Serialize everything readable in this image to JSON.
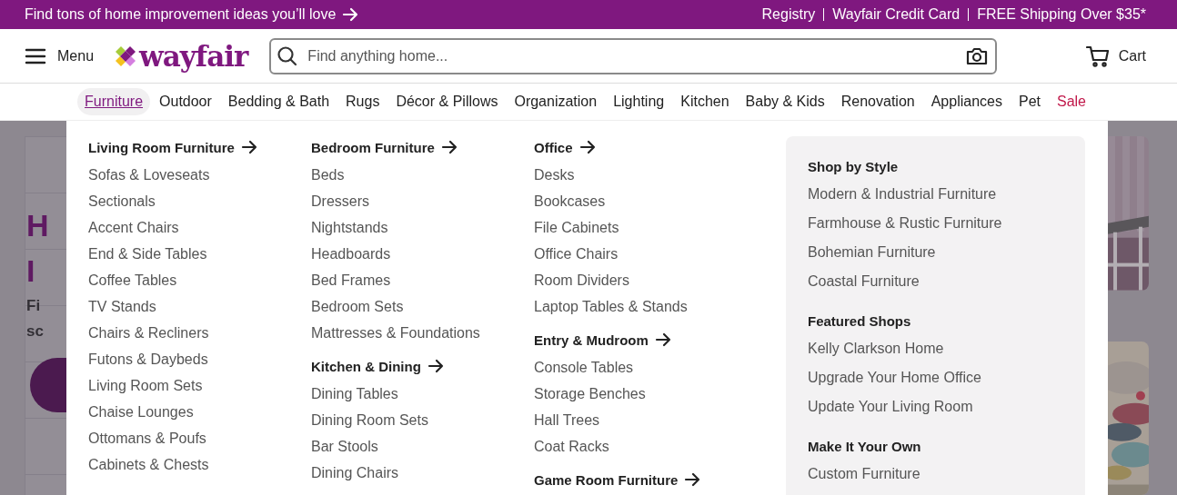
{
  "promo_bar": {
    "text": "Find tons of home improvement ideas you’ll love",
    "links": [
      "Registry",
      "Wayfair Credit Card",
      "FREE Shipping Over $35*"
    ]
  },
  "header": {
    "menu_label": "Menu",
    "logo": "wayfair",
    "search": {
      "placeholder": "Find anything home..."
    },
    "cart_label": "Cart"
  },
  "nav": [
    {
      "label": "Furniture",
      "selected": true,
      "kind": "normal"
    },
    {
      "label": "Outdoor",
      "selected": false,
      "kind": "normal"
    },
    {
      "label": "Bedding & Bath",
      "selected": false,
      "kind": "normal"
    },
    {
      "label": "Rugs",
      "selected": false,
      "kind": "normal"
    },
    {
      "label": "Décor & Pillows",
      "selected": false,
      "kind": "normal"
    },
    {
      "label": "Organization",
      "selected": false,
      "kind": "normal"
    },
    {
      "label": "Lighting",
      "selected": false,
      "kind": "normal"
    },
    {
      "label": "Kitchen",
      "selected": false,
      "kind": "normal"
    },
    {
      "label": "Baby & Kids",
      "selected": false,
      "kind": "normal"
    },
    {
      "label": "Renovation",
      "selected": false,
      "kind": "normal"
    },
    {
      "label": "Appliances",
      "selected": false,
      "kind": "normal"
    },
    {
      "label": "Pet",
      "selected": false,
      "kind": "normal"
    },
    {
      "label": "Sale",
      "selected": false,
      "kind": "sale"
    }
  ],
  "background_page": {
    "hero_texts": [
      "H",
      "I",
      "Fi",
      "sc"
    ]
  },
  "menu_columns": [
    [
      {
        "heading": "Living Room Furniture",
        "items": [
          "Sofas & Loveseats",
          "Sectionals",
          "Accent Chairs",
          "End & Side Tables",
          "Coffee Tables",
          "TV Stands",
          "Chairs & Recliners",
          "Futons & Daybeds",
          "Living Room Sets",
          "Chaise Lounges",
          "Ottomans & Poufs",
          "Cabinets & Chests"
        ]
      }
    ],
    [
      {
        "heading": "Bedroom Furniture",
        "items": [
          "Beds",
          "Dressers",
          "Nightstands",
          "Headboards",
          "Bed Frames",
          "Bedroom Sets",
          "Mattresses & Foundations"
        ]
      },
      {
        "heading": "Kitchen & Dining",
        "items": [
          "Dining Tables",
          "Dining Room Sets",
          "Bar Stools",
          "Dining Chairs"
        ]
      }
    ],
    [
      {
        "heading": "Office",
        "items": [
          "Desks",
          "Bookcases",
          "File Cabinets",
          "Office Chairs",
          "Room Dividers",
          "Laptop Tables & Stands"
        ]
      },
      {
        "heading": "Entry & Mudroom",
        "items": [
          "Console Tables",
          "Storage Benches",
          "Hall Trees",
          "Coat Racks"
        ]
      },
      {
        "heading": "Game Room Furniture"
      }
    ]
  ],
  "side_panel": [
    {
      "heading": "Shop by Style",
      "items": [
        "Modern & Industrial Furniture",
        "Farmhouse & Rustic Furniture",
        "Bohemian Furniture",
        "Coastal Furniture"
      ]
    },
    {
      "heading": "Featured Shops",
      "items": [
        "Kelly Clarkson Home",
        "Upgrade Your Home Office",
        "Update Your Living Room"
      ]
    },
    {
      "heading": "Make It Your Own",
      "items": [
        "Custom Furniture"
      ]
    }
  ]
}
